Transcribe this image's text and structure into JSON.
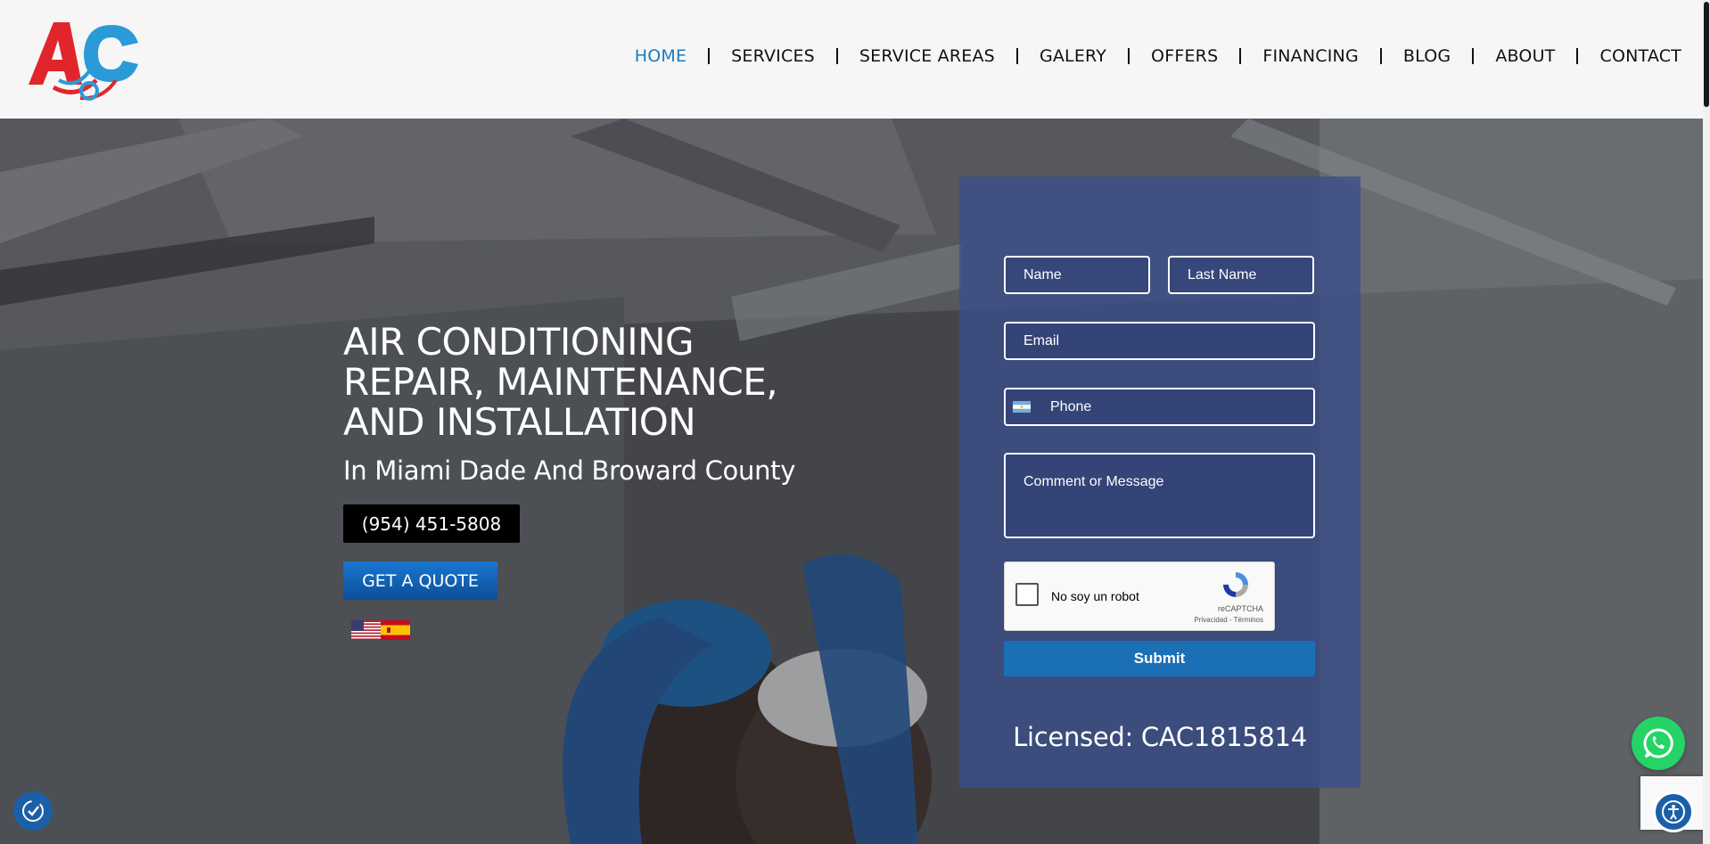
{
  "header": {
    "logo_text": "AC",
    "nav": [
      {
        "label": "HOME",
        "active": true
      },
      {
        "label": "SERVICES",
        "active": false
      },
      {
        "label": "SERVICE AREAS",
        "active": false
      },
      {
        "label": "GALERY",
        "active": false
      },
      {
        "label": "OFFERS",
        "active": false
      },
      {
        "label": "FINANCING",
        "active": false
      },
      {
        "label": "BLOG",
        "active": false
      },
      {
        "label": "ABOUT",
        "active": false
      },
      {
        "label": "CONTACT",
        "active": false
      }
    ]
  },
  "hero": {
    "title_lines": [
      "AIR CONDITIONING",
      "REPAIR, MAINTENANCE,",
      "AND INSTALLATION"
    ],
    "subtitle": "In Miami Dade And Broward County",
    "phone_label": "(954) 451-5808",
    "quote_label": "GET A QUOTE",
    "languages": [
      "english-flag",
      "spanish-flag"
    ]
  },
  "form": {
    "name_placeholder": "Name",
    "last_name_placeholder": "Last Name",
    "email_placeholder": "Email",
    "phone_placeholder": "Phone",
    "comment_placeholder": "Comment  or Message",
    "recaptcha_label": "No soy un robot",
    "recaptcha_brand": "reCAPTCHA",
    "recaptcha_links": "Privacidad - Términos",
    "submit_label": "Submit",
    "licensed": "Licensed: CAC1815814"
  },
  "colors": {
    "nav_active": "#1a7bbf",
    "form_panel": "#3a4e8c",
    "submit": "#1b6fb4",
    "whatsapp": "#25d366",
    "accessibility": "#1b5fa8"
  }
}
